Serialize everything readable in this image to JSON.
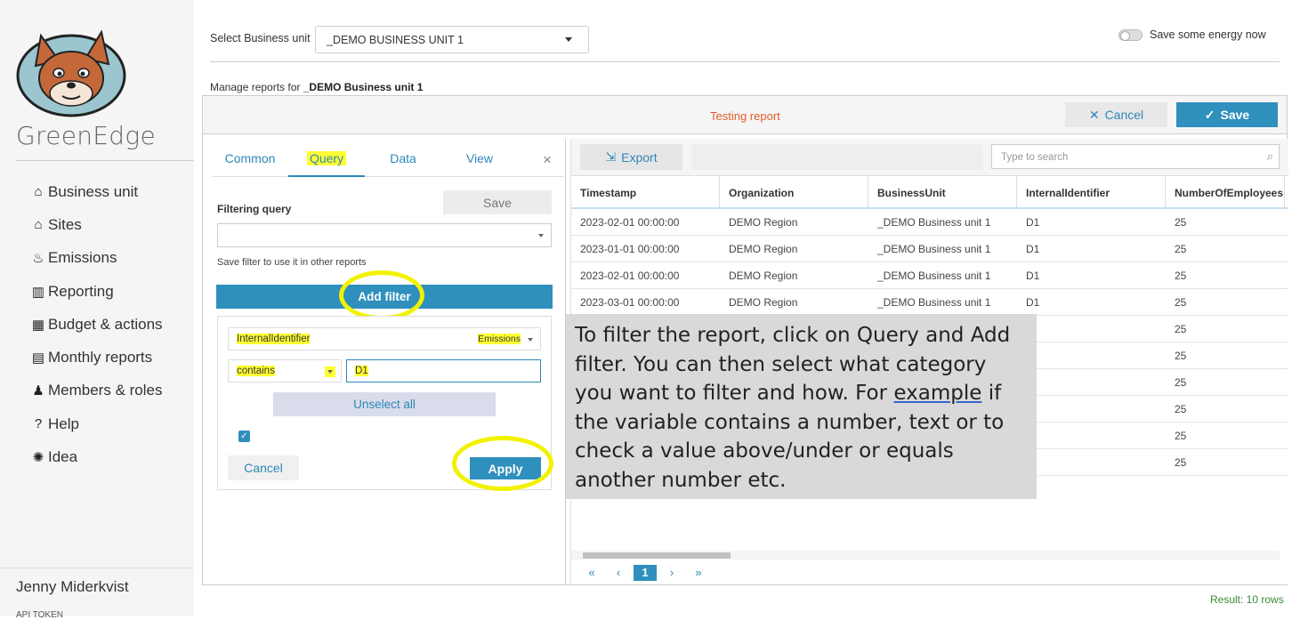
{
  "sidebar": {
    "brand": "GreenEdge",
    "items": [
      {
        "label": "Business unit",
        "icon": "⌂"
      },
      {
        "label": "Sites",
        "icon": "⌂"
      },
      {
        "label": "Emissions",
        "icon": "♨"
      },
      {
        "label": "Reporting",
        "icon": "▥"
      },
      {
        "label": "Budget & actions",
        "icon": "▦"
      },
      {
        "label": "Monthly reports",
        "icon": "▤"
      },
      {
        "label": "Members & roles",
        "icon": "♟"
      },
      {
        "label": "Help",
        "icon": "?"
      },
      {
        "label": "Idea",
        "icon": "✺"
      }
    ],
    "user": "Jenny Miderkvist",
    "api_token": "API TOKEN"
  },
  "header": {
    "bu_label": "Select Business unit",
    "bu_value": "_DEMO BUSINESS UNIT 1",
    "energy_label": "Save some energy now",
    "manage_prefix": "Manage reports for",
    "manage_unit": "_DEMO Business unit 1"
  },
  "report": {
    "title": "Testing report",
    "cancel_label": "Cancel",
    "save_label": "Save"
  },
  "query_panel": {
    "tabs": [
      "Common",
      "Query",
      "Data",
      "View"
    ],
    "active_tab": "Query",
    "close_icon": "×",
    "filtering_label": "Filtering query",
    "save_label": "Save",
    "hint": "Save filter to use it in other reports",
    "add_filter_label": "Add filter",
    "filter": {
      "field": "InternalIdentifier",
      "source": "Emissions",
      "operator": "contains",
      "value": "D1",
      "unselect_label": "Unselect all",
      "checked": true,
      "cancel_label": "Cancel",
      "apply_label": "Apply"
    }
  },
  "grid": {
    "export_label": "Export",
    "search_placeholder": "Type to search",
    "columns": [
      "Timestamp",
      "Organization",
      "BusinessUnit",
      "InternalIdentifier",
      "NumberOfEmployees"
    ],
    "rows": [
      [
        "2023-02-01 00:00:00",
        "DEMO Region",
        "_DEMO Business unit 1",
        "D1",
        "25"
      ],
      [
        "2023-01-01 00:00:00",
        "DEMO Region",
        "_DEMO Business unit 1",
        "D1",
        "25"
      ],
      [
        "2023-02-01 00:00:00",
        "DEMO Region",
        "_DEMO Business unit 1",
        "D1",
        "25"
      ],
      [
        "2023-03-01 00:00:00",
        "DEMO Region",
        "_DEMO Business unit 1",
        "D1",
        "25"
      ],
      [
        "",
        "",
        "",
        "",
        "25"
      ],
      [
        "",
        "",
        "",
        "",
        "25"
      ],
      [
        "",
        "",
        "",
        "",
        "25"
      ],
      [
        "",
        "",
        "",
        "",
        "25"
      ],
      [
        "",
        "",
        "",
        "",
        "25"
      ],
      [
        "",
        "",
        "",
        "",
        "25"
      ]
    ],
    "pager": {
      "first": "«",
      "prev": "‹",
      "current": "1",
      "next": "›",
      "last": "»"
    },
    "result": "Result: 10 rows"
  },
  "callout": {
    "text_before": "To filter the report, click on Query and Add filter. You can then select what category you want to filter and how. For ",
    "underlined": "example",
    "text_after": " if the variable contains a number, text or to check a value above/under or equals another number etc."
  },
  "colors": {
    "accent": "#2f8fbd",
    "title_orange": "#e25c2a",
    "highlight": "#ffff33"
  }
}
